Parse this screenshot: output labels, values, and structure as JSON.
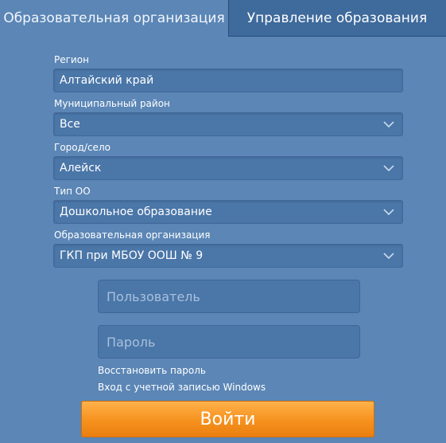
{
  "tabs": {
    "active": "Образовательная организация",
    "inactive": "Управление образования"
  },
  "form": {
    "region": {
      "label": "Регион",
      "value": "Алтайский край"
    },
    "district": {
      "label": "Муниципальный район",
      "value": "Все"
    },
    "city": {
      "label": "Город/село",
      "value": "Алейск"
    },
    "org_type": {
      "label": "Тип ОО",
      "value": "Дошкольное образование"
    },
    "organization": {
      "label": "Образовательная организация",
      "value": "ГКП при МБОУ ООШ № 9"
    }
  },
  "auth": {
    "username_placeholder": "Пользователь",
    "password_placeholder": "Пароль",
    "restore_password": "Восстановить пароль",
    "windows_login": "Вход с учетной записью Windows",
    "login_button": "Войти"
  },
  "icons": {
    "dropdown": "chevron-down-icon"
  },
  "colors": {
    "background": "#5b86b6",
    "inactive_tab": "#3e6a9c",
    "field": "#4a76a8",
    "button": "#f6911e"
  }
}
